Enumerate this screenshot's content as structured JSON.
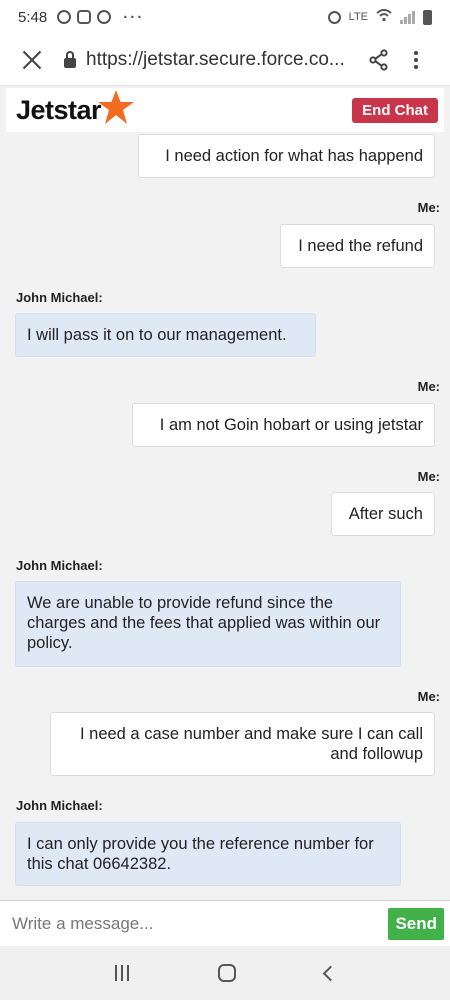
{
  "status_bar": {
    "time": "5:48",
    "more": "···",
    "lte": "LTE"
  },
  "browser": {
    "url": "https://jetstar.secure.force.co..."
  },
  "header": {
    "brand": "Jetstar",
    "end_chat_label": "End Chat"
  },
  "messages": [
    {
      "sender": "",
      "text": "I need action for what has happend",
      "role": "me"
    },
    {
      "sender": "Me:",
      "text": "I need the refund",
      "role": "me"
    },
    {
      "sender": "John Michael:",
      "text": "I will pass it on to our management.",
      "role": "agent"
    },
    {
      "sender": "Me:",
      "text": "I am not Goin hobart or using jetstar",
      "role": "me"
    },
    {
      "sender": "Me:",
      "text": "After such",
      "role": "me"
    },
    {
      "sender": "John Michael:",
      "text": "We are unable to provide refund since the charges and the fees that applied was within our policy.",
      "role": "agent"
    },
    {
      "sender": "Me:",
      "text": "I need a case number and make sure I can call and followup",
      "role": "me"
    },
    {
      "sender": "John Michael:",
      "text": "I can only provide you the reference number for this chat 06642382.",
      "role": "agent"
    }
  ],
  "composer": {
    "placeholder": "Write a message...",
    "send_label": "Send"
  },
  "colors": {
    "brand_star": "#f26b21",
    "end_chat": "#c9354a",
    "send": "#43b14a",
    "agent_bubble": "#dfe9f5"
  }
}
